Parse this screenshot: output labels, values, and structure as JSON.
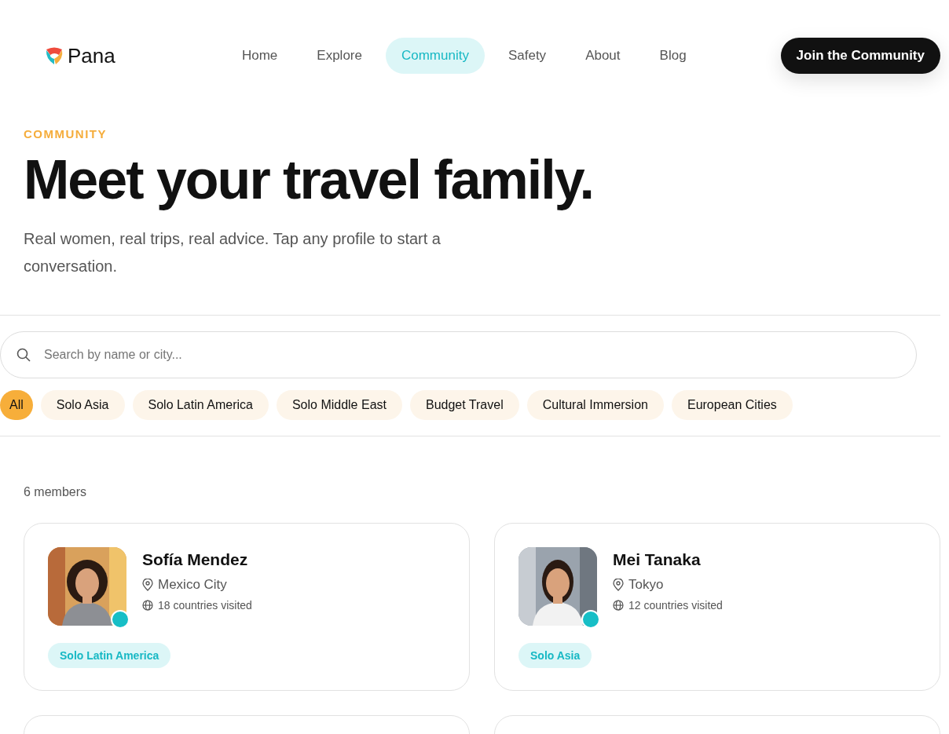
{
  "brand": {
    "name": "Pana"
  },
  "nav": [
    {
      "label": "Home",
      "selected": false
    },
    {
      "label": "Explore",
      "selected": false
    },
    {
      "label": "Community",
      "selected": true
    },
    {
      "label": "Safety",
      "selected": false
    },
    {
      "label": "About",
      "selected": false
    },
    {
      "label": "Blog",
      "selected": false
    }
  ],
  "cta": "Join the Community",
  "eyebrow": "COMMUNITY",
  "title": "Meet your travel family.",
  "subtitle": "Real women, real trips, real advice. Tap any profile to start a conversation.",
  "search": {
    "placeholder": "Search by name or city..."
  },
  "filters": [
    {
      "label": "All",
      "selected": true
    },
    {
      "label": "Solo Asia",
      "selected": false
    },
    {
      "label": "Solo Latin America",
      "selected": false
    },
    {
      "label": "Solo Middle East",
      "selected": false
    },
    {
      "label": "Budget Travel",
      "selected": false
    },
    {
      "label": "Cultural Immersion",
      "selected": false
    },
    {
      "label": "European Cities",
      "selected": false
    }
  ],
  "count": "6 members",
  "members": [
    {
      "name": "Sofía Mendez",
      "city": "Mexico City",
      "visited": "18 countries visited",
      "tag": "Solo Latin America",
      "online": true
    },
    {
      "name": "Mei Tanaka",
      "city": "Tokyo",
      "visited": "12 countries visited",
      "tag": "Solo Asia",
      "online": true
    }
  ]
}
